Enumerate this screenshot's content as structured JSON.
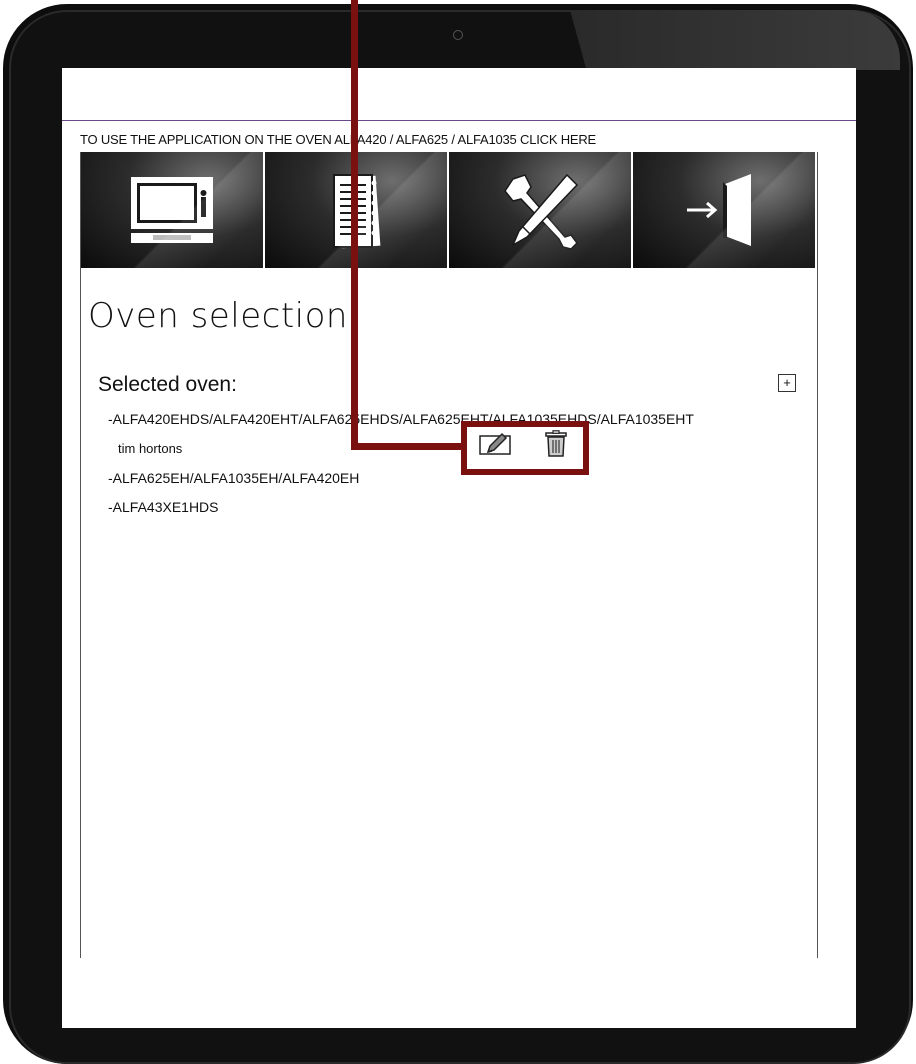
{
  "notice": {
    "text": "TO USE THE APPLICATION ON THE OVEN ALFA420 / ALFA625 / ALFA1035 CLICK HERE"
  },
  "nav": {
    "items": [
      {
        "icon": "oven-icon"
      },
      {
        "icon": "notebook-icon"
      },
      {
        "icon": "tools-icon"
      },
      {
        "icon": "exit-door-icon"
      }
    ]
  },
  "page": {
    "title": "Oven selection"
  },
  "selected": {
    "heading": "Selected oven:",
    "add_label": "+",
    "ovens": [
      {
        "label": "-ALFA420EHDS/ALFA420EHT/ALFA625EHDS/ALFA625EHT/ALFA1035EHDS/ALFA1035EHT",
        "sub": "tim hortons"
      },
      {
        "label": "-ALFA625EH/ALFA1035EH/ALFA420EH"
      },
      {
        "label": "-ALFA43XE1HDS"
      }
    ]
  },
  "colors": {
    "callout": "#7a1010",
    "accent_line": "#6b4a8a"
  }
}
